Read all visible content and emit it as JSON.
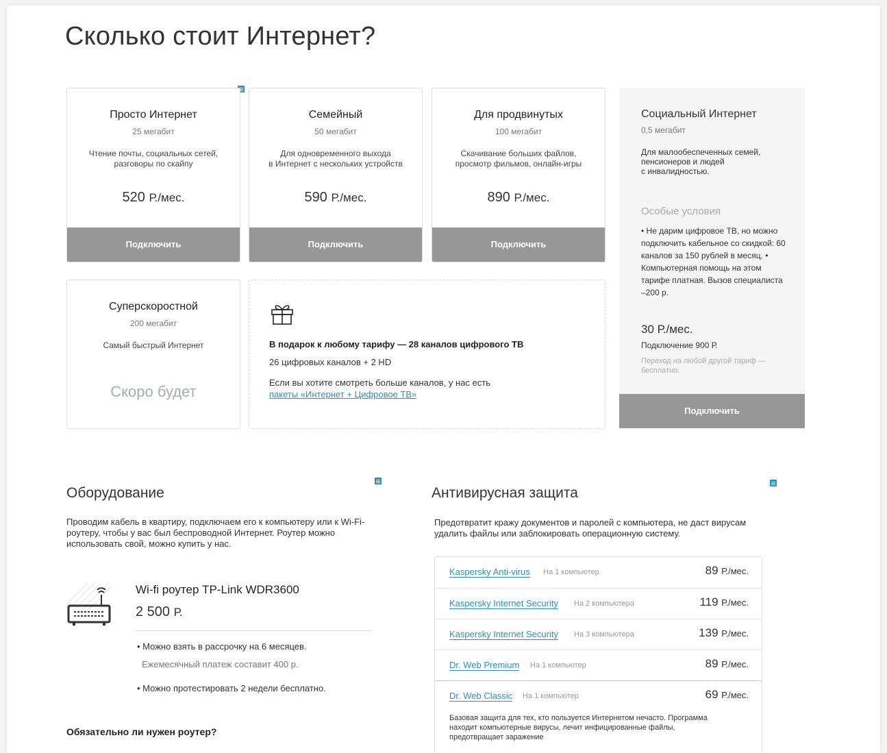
{
  "page_title": "Сколько стоит Интернет?",
  "tariffs": [
    {
      "name": "Просто Интернет",
      "speed": "25 мегабит",
      "desc": "Чтение почты, социальных сетей,\nразговоры по скайпу",
      "price": "520",
      "unit": "Р./мес.",
      "button": "Подключить"
    },
    {
      "name": "Семейный",
      "speed": "50 мегабит",
      "desc": "Для одновременного выхода\nв Интернет с нескольких устройств",
      "price": "590",
      "unit": "Р./мес.",
      "button": "Подключить"
    },
    {
      "name": "Для продвинутых",
      "speed": "100 мегабит",
      "desc": "Скачивание больших файлов,\nпросмотр фильмов, онлайн-игры",
      "price": "890",
      "unit": "Р./мес.",
      "button": "Подключить"
    },
    {
      "name": "Суперскоростной",
      "speed": "200 мегабит",
      "desc": "Самый быстрый Интернет",
      "soon": "Скоро будет"
    }
  ],
  "gift": {
    "title": "В подарок к любому тарифу — 28 каналов цифрового ТВ",
    "line1": "26 цифровых каналов + 2 HD",
    "line2": "Если вы хотите смотреть больше каналов, у нас есть",
    "link": "пакеты «Интернет + Цифровое ТВ»"
  },
  "social": {
    "name": "Социальный Интернет",
    "speed": "0,5 мегабит",
    "desc": "Для малообеспеченных семей,\nпенсионеров и людей\nс инвалидностью.",
    "conditions_title": "Особые условия",
    "conditions": "• Не дарим цифровое ТВ, но можно подключить кабельное со скидкой: 60 каналов за 150 рублей в месяц. • Компьютерная помощь на этом тарифе платная. Вызов специалиста –200 р.",
    "price": "30 Р./мес.",
    "connection": "Подключение 900 Р.",
    "note": "Переход на любой другой тариф —\nбесплатно.",
    "button": "Подключить"
  },
  "equipment": {
    "title": "Оборудование",
    "text": "Проводим кабель в квартиру, подключаем его к компьютеру или к Wi-Fi-роутеру, чтобы у вас был беспроводной Интернет. Роутер можно использовать свой, можно купить у нас.",
    "router_name": "Wi-fi роутер TP-Link WDR3600",
    "router_price": "2 500",
    "router_unit": "Р.",
    "bullet1": "• Можно взять в рассрочку на 6 месяцев.",
    "bullet1_sub": "Ежемесячный платеж составит 400 р.",
    "bullet2": "• Можно протестировать 2 недели бесплатно.",
    "faq": "Обязательно ли нужен роутер?"
  },
  "antivirus": {
    "title": "Антивирусная защита",
    "text": "Предотвратит кражу документов и паролей с компьютера, не даст вирусам удалить файлы или заблокировать операционную систему.",
    "unit": "Р./мес.",
    "items": [
      {
        "name": "Kaspersky Anti-virus",
        "count": "На 1 компьютер",
        "price": "89"
      },
      {
        "name": "Kaspersky Internet Security",
        "count": "На 2 компьютера",
        "price": "119"
      },
      {
        "name": "Kaspersky Internet Security",
        "count": "На 3 компьютера",
        "price": "139"
      },
      {
        "name": "Dr. Web Premium",
        "count": "На 1 компьютер",
        "price": "89"
      },
      {
        "name": "Dr. Web Classic",
        "count": "На 1 компьютер",
        "price": "69",
        "desc": "Базовая защита для тех, кто пользуется Интернетом нечасто. Программа находит компьютерные вирусы, лечит инфицированные файлы, предотвращает заражение"
      }
    ]
  },
  "colors": {
    "accent": "#2a8fc7",
    "button": "#979797",
    "soon": "#a4acb6"
  }
}
